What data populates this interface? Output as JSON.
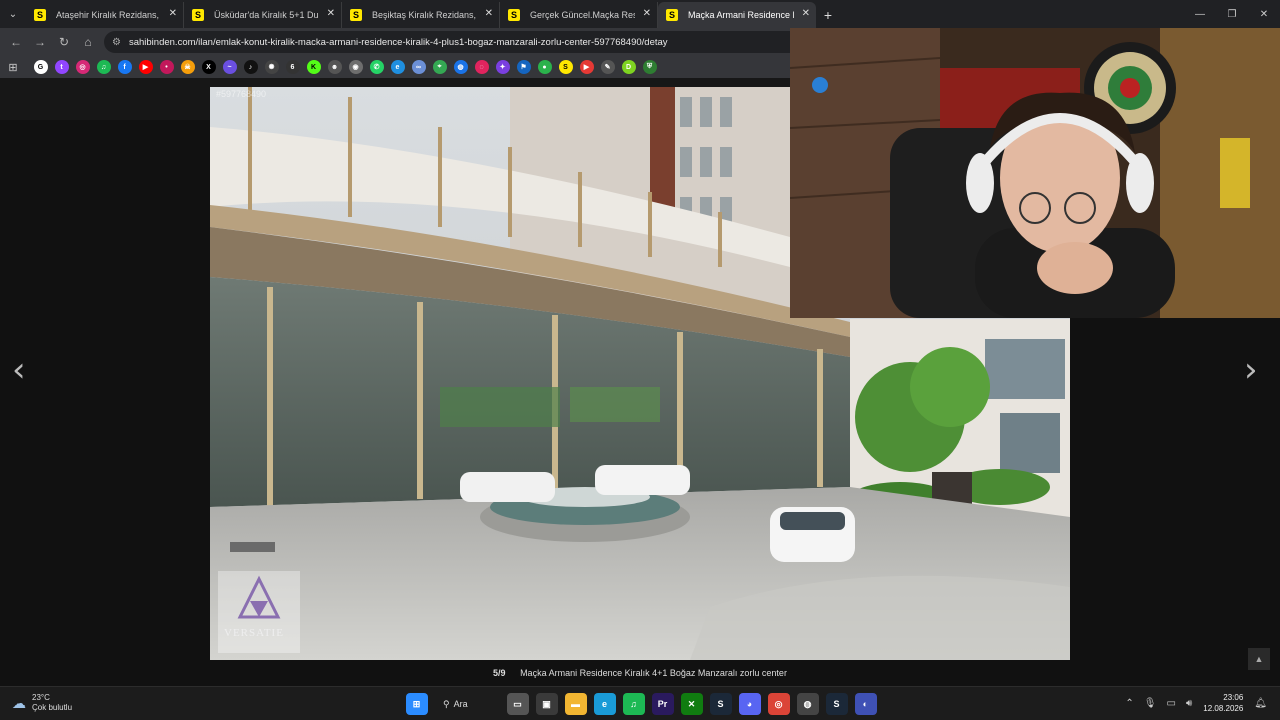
{
  "browser": {
    "tabs": [
      {
        "favicon": "S",
        "title": "Ataşehir Kiralık Rezidans, Villa, M",
        "active": false
      },
      {
        "favicon": "S",
        "title": "Üsküdar'da Kiralık 5+1 Dubleks",
        "active": false
      },
      {
        "favicon": "S",
        "title": "Beşiktaş Kiralık Rezidans, Villa, M",
        "active": false
      },
      {
        "favicon": "S",
        "title": "Gerçek Güncel.Maçka Residence",
        "active": false
      },
      {
        "favicon": "S",
        "title": "Maçka Armani Residence Kiralık",
        "active": true
      }
    ],
    "new_tab": "+",
    "url": "sahibinden.com/ilan/emlak-konut-kiralik-macka-armani-residence-kiralik-4-plus1-bogaz-manzarali-zorlu-center-597768490/detay",
    "bookmark_icons": [
      {
        "name": "google",
        "label": "G",
        "color": "#ffffff"
      },
      {
        "name": "twitch",
        "label": "t",
        "color": "#9146ff"
      },
      {
        "name": "instagram",
        "label": "◎",
        "color": "#d62976"
      },
      {
        "name": "spotify",
        "label": "♫",
        "color": "#1db954"
      },
      {
        "name": "facebook",
        "label": "f",
        "color": "#1877f2"
      },
      {
        "name": "youtube",
        "label": "▶",
        "color": "#ff0000"
      },
      {
        "name": "red-bookmark",
        "label": "•",
        "color": "#c2185b"
      },
      {
        "name": "game-bookmark",
        "label": "☠",
        "color": "#f59e0b"
      },
      {
        "name": "x",
        "label": "X",
        "color": "#000000"
      },
      {
        "name": "kick-purple",
        "label": "~",
        "color": "#6a4fe0"
      },
      {
        "name": "tiktok",
        "label": "♪",
        "color": "#111111"
      },
      {
        "name": "openai",
        "label": "✺",
        "color": "#444444"
      },
      {
        "name": "letter-six",
        "label": "6",
        "color": "#333333"
      },
      {
        "name": "kick",
        "label": "K",
        "color": "#53fc18"
      },
      {
        "name": "reddit-like",
        "label": "☻",
        "color": "#555555"
      },
      {
        "name": "globe",
        "label": "◉",
        "color": "#6e6e6e"
      },
      {
        "name": "whatsapp",
        "label": "✆",
        "color": "#25d366"
      },
      {
        "name": "edge-like",
        "label": "e",
        "color": "#1f8fe0"
      },
      {
        "name": "link",
        "label": "∞",
        "color": "#6b8fd6"
      },
      {
        "name": "maps",
        "label": "⌖",
        "color": "#34a853"
      },
      {
        "name": "blue-globe",
        "label": "◍",
        "color": "#1a73e8"
      },
      {
        "name": "pink-ring",
        "label": "◌",
        "color": "#e0245e"
      },
      {
        "name": "community",
        "label": "✦",
        "color": "#7a3fe0"
      },
      {
        "name": "flag",
        "label": "⚑",
        "color": "#1565c0"
      },
      {
        "name": "green-circle",
        "label": "●",
        "color": "#2bb24c"
      },
      {
        "name": "sahibinden",
        "label": "S",
        "color": "#ffe800"
      },
      {
        "name": "red-play",
        "label": "▶",
        "color": "#e53935"
      },
      {
        "name": "tool",
        "label": "✎",
        "color": "#555555"
      },
      {
        "name": "d-bookmark",
        "label": "D",
        "color": "#7ed321"
      },
      {
        "name": "shield",
        "label": "⛨",
        "color": "#2e7d32"
      }
    ]
  },
  "listing": {
    "id_text": "#597768490",
    "photo_counter": "5/9",
    "photo_caption": "Maçka Armani Residence Kiralık 4+1 Boğaz Manzaralı zorlu center",
    "watermark": "VERSATIE"
  },
  "taskbar": {
    "weather_temp": "23°C",
    "weather_desc": "Çok bulutlu",
    "search_label": "Ara",
    "time": "23:06",
    "date": "12.08.2026",
    "apps": [
      {
        "name": "start",
        "label": "⊞",
        "color": "#2b8cff"
      },
      {
        "name": "task-view",
        "label": "▭",
        "color": "#555555"
      },
      {
        "name": "store",
        "label": "▣",
        "color": "#3a3a3a"
      },
      {
        "name": "explorer",
        "label": "▬",
        "color": "#f2b632"
      },
      {
        "name": "edge",
        "label": "e",
        "color": "#1a9bd7"
      },
      {
        "name": "spotify",
        "label": "♫",
        "color": "#1db954"
      },
      {
        "name": "premiere",
        "label": "Pr",
        "color": "#2a1a5e"
      },
      {
        "name": "xbox",
        "label": "✕",
        "color": "#107c10"
      },
      {
        "name": "steam",
        "label": "S",
        "color": "#1b2838"
      },
      {
        "name": "discord",
        "label": "◕",
        "color": "#5865f2"
      },
      {
        "name": "chrome",
        "label": "◎",
        "color": "#db4437"
      },
      {
        "name": "obs",
        "label": "◍",
        "color": "#444444"
      },
      {
        "name": "steam-2",
        "label": "S",
        "color": "#1b2838"
      },
      {
        "name": "app-blue",
        "label": "◐",
        "color": "#3f51b5"
      }
    ]
  }
}
